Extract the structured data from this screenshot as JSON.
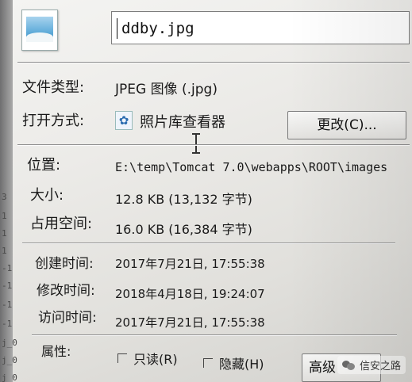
{
  "file": {
    "name": "ddby.jpg"
  },
  "general": {
    "type_label": "文件类型:",
    "type_value": "JPEG 图像 (.jpg)",
    "opens_with_label": "打开方式:",
    "opens_with_app": "照片库查看器",
    "change_button": "更改(C)...",
    "location_label": "位置:",
    "location_value": "E:\\temp\\Tomcat 7.0\\webapps\\ROOT\\images",
    "size_label": "大小:",
    "size_value": "12.8 KB (13,132 字节)",
    "size_on_disk_label": "占用空间:",
    "size_on_disk_value": "16.0 KB (16,384 字节)",
    "created_label": "创建时间:",
    "created_value": "2017年7月21日, 17:55:38",
    "modified_label": "修改时间:",
    "modified_value": "2018年4月18日, 19:24:07",
    "accessed_label": "访问时间:",
    "accessed_value": "2017年7月21日, 17:55:38",
    "attributes_label": "属性:",
    "readonly_label": "只读(R)",
    "hidden_label": "隐藏(H)",
    "advanced_button": "高级"
  },
  "edge_text": [
    "3",
    "1",
    "1",
    "1",
    "-1",
    "-1",
    "-1",
    "-1",
    "j_0",
    "j_0",
    "j_0"
  ],
  "watermark": {
    "text": "信安之路"
  },
  "icons": {
    "file_icon": "image-file-icon",
    "app_icon": "photo-viewer-icon",
    "cursor": "ibeam-cursor-icon",
    "watermark_icon": "wechat-icon"
  },
  "colors": {
    "dialog_bg": "#ecebe8",
    "text": "#1a1a1a",
    "divider": "#8f8f8f"
  }
}
